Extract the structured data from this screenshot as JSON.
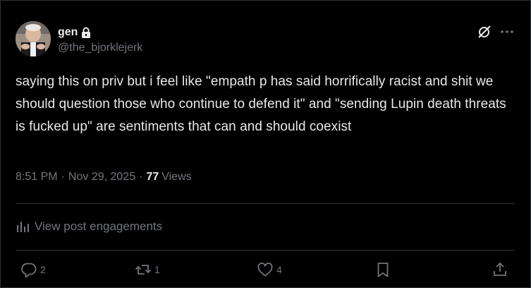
{
  "author": {
    "display_name": "gen",
    "handle": "@the_bjorklejerk",
    "protected": true
  },
  "tweet": {
    "text": "saying this on priv but i feel like \"empath p has said horrifically racist and shit we should question those who continue to defend it\" and \"sending Lupin death threats is fucked up\" are sentiments that can and should coexist",
    "time": "8:51 PM",
    "date": "Nov 29, 2025",
    "views_count": "77",
    "views_label": "Views"
  },
  "engagements_link": "View post engagements",
  "actions": {
    "replies": "2",
    "reposts": "1",
    "likes": "4"
  },
  "icons": {
    "lock": "lock-icon",
    "grok": "grok-icon",
    "more": "more-icon",
    "engagements": "bar-chart-icon",
    "reply": "reply-icon",
    "repost": "repost-icon",
    "like": "heart-icon",
    "bookmark": "bookmark-icon",
    "share": "share-icon"
  },
  "colors": {
    "background": "#000000",
    "text": "#e7e9ea",
    "muted": "#71767b",
    "divider": "#2f3336"
  }
}
